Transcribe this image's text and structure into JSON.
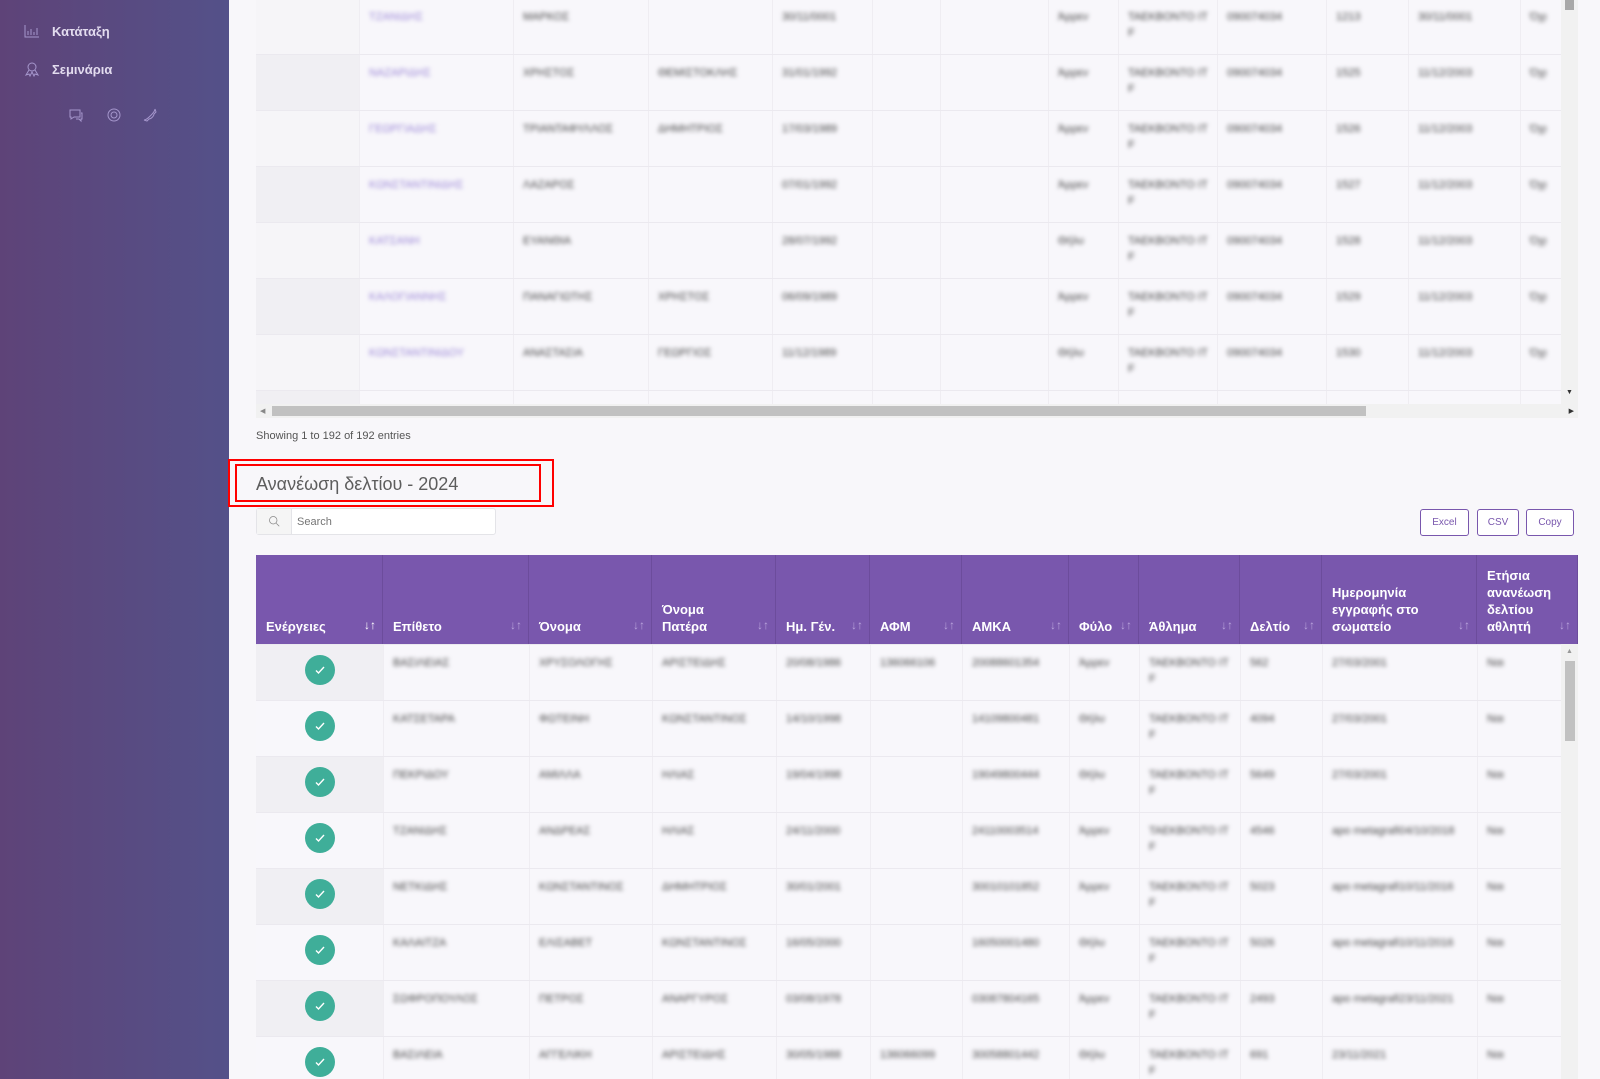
{
  "sidebar": {
    "items": [
      {
        "label": "Κατάταξη",
        "icon": "bar-chart-icon"
      },
      {
        "label": "Σεμινάρια",
        "icon": "award-icon"
      }
    ],
    "footer_icons": [
      "chat-icon",
      "lifebuoy-icon",
      "phone-icon"
    ]
  },
  "top_table": {
    "rows": [
      [
        "",
        "ΤΖΑΝΙΔΗΣ",
        "ΜΑΡΚΟΣ",
        "",
        "30/11/0001",
        "",
        "",
        "Άρρεν",
        "ΤΑΕΚΒΟΝΤΟ ITF",
        "090074034",
        "1213",
        "30/11/0001",
        "Όχι"
      ],
      [
        "",
        "ΝΑΖΑΡΙΔΗΣ",
        "ΧΡΗΣΤΟΣ",
        "ΘΕΜΙΣΤΟΚΛΗΣ",
        "31/01/1992",
        "",
        "",
        "Άρρεν",
        "ΤΑΕΚΒΟΝΤΟ ITF",
        "090074034",
        "1525",
        "11/12/2003",
        "Όχι"
      ],
      [
        "",
        "ΓΕΩΡΓΙΑΔΗΣ",
        "ΤΡΙΑΝΤΑΦΥΛΛΟΣ",
        "ΔΗΜΗΤΡΙΟΣ",
        "17/03/1989",
        "",
        "",
        "Άρρεν",
        "ΤΑΕΚΒΟΝΤΟ ITF",
        "090074034",
        "1526",
        "11/12/2003",
        "Όχι"
      ],
      [
        "",
        "ΚΩΝΣΤΑΝΤΙΝΙΔΗΣ",
        "ΛΑΖΑΡΟΣ",
        "",
        "07/01/1992",
        "",
        "",
        "Άρρεν",
        "ΤΑΕΚΒΟΝΤΟ ITF",
        "090074034",
        "1527",
        "11/12/2003",
        "Όχι"
      ],
      [
        "",
        "ΚΑΤΣΑΝΗ",
        "ΕΥΑΝΘΙΑ",
        "",
        "28/07/1992",
        "",
        "",
        "Θήλυ",
        "ΤΑΕΚΒΟΝΤΟ ITF",
        "090074034",
        "1528",
        "11/12/2003",
        "Όχι"
      ],
      [
        "",
        "ΚΑΛΟΓΙΑΝΝΗΣ",
        "ΠΑΝΑΓΙΩΤΗΣ",
        "ΧΡΗΣΤΟΣ",
        "06/09/1989",
        "",
        "",
        "Άρρεν",
        "ΤΑΕΚΒΟΝΤΟ ITF",
        "090074034",
        "1529",
        "11/12/2003",
        "Όχι"
      ],
      [
        "",
        "ΚΩΝΣΤΑΝΤΙΝΙΔΟΥ",
        "ΑΝΑΣΤΑΣΙΑ",
        "ΓΕΩΡΓΙΟΣ",
        "11/12/1989",
        "",
        "",
        "Θήλυ",
        "ΤΑΕΚΒΟΝΤΟ ITF",
        "090074034",
        "1530",
        "11/12/2003",
        "Όχι"
      ]
    ],
    "info": "Showing 1 to 192 of 192 entries"
  },
  "section": {
    "title": "Ανανέωση δελτίου - 2024",
    "search_placeholder": "Search",
    "buttons": [
      "Excel",
      "CSV",
      "Copy"
    ]
  },
  "bottom_table": {
    "headers": [
      "Ενέργειες",
      "Επίθετο",
      "Όνομα",
      "Όνομα Πατέρα",
      "Ημ. Γέν.",
      "ΑΦΜ",
      "ΑΜΚΑ",
      "Φύλο",
      "Άθλημα",
      "Δελτίο",
      "Ημερομηνία εγγραφής στο σωματείο",
      "Ετήσια ανανέωση δελτίου αθλητή"
    ],
    "action_icon": "check-circle-icon",
    "rows": [
      [
        "ΒΑΣΙΛΕΙΑΣ",
        "ΧΡΥΣΟΛΟΓΗΣ",
        "ΑΡΙΣΤΕΙΔΗΣ",
        "20/08/1986",
        "136066106",
        "20088601354",
        "Άρρεν",
        "ΤΑΕΚΒΟΝΤΟ ITF",
        "562",
        "27/03/2001",
        "Ναι"
      ],
      [
        "ΚΑΤΣΕΤΑΡΑ",
        "ΦΩΤΕΙΝΗ",
        "ΚΩΝΣΤΑΝΤΙΝΟΣ",
        "14/10/1998",
        "",
        "14109800481",
        "Θήλυ",
        "ΤΑΕΚΒΟΝΤΟ ITF",
        "4094",
        "27/03/2001",
        "Ναι"
      ],
      [
        "ΠΕΚΡΙΔΟΥ",
        "ΑΜΙΛΛΑ",
        "ΗΛΙΑΣ",
        "19/04/1998",
        "",
        "19049800444",
        "Θήλυ",
        "ΤΑΕΚΒΟΝΤΟ ITF",
        "5649",
        "27/03/2001",
        "Ναι"
      ],
      [
        "ΤΖΑΝΙΔΗΣ",
        "ΑΝΔΡΕΑΣ",
        "ΗΛΙΑΣ",
        "24/11/2000",
        "",
        "24110003514",
        "Άρρεν",
        "ΤΑΕΚΒΟΝΤΟ ITF",
        "4546",
        "apo metagrafi04/10/2018",
        "Ναι"
      ],
      [
        "ΝΕΤΚΙΔΗΣ",
        "ΚΩΝΣΤΑΝΤΙΝΟΣ",
        "ΔΗΜΗΤΡΙΟΣ",
        "30/01/2001",
        "",
        "30010101852",
        "Άρρεν",
        "ΤΑΕΚΒΟΝΤΟ ITF",
        "5023",
        "apo metagrafi10/11/2016",
        "Ναι"
      ],
      [
        "ΚΑΛΑΙΤΖΑ",
        "ΕΛΙΣΑΒΕΤ",
        "ΚΩΝΣΤΑΝΤΙΝΟΣ",
        "16/05/2000",
        "",
        "16050001480",
        "Θήλυ",
        "ΤΑΕΚΒΟΝΤΟ ITF",
        "5026",
        "apo metagrafi10/11/2016",
        "Ναι"
      ],
      [
        "ΣΩΦΡΟΠΟΥΛΟΣ",
        "ΠΕΤΡΟΣ",
        "ΑΝΑΡΓΥΡΟΣ",
        "03/08/1978",
        "",
        "03087804165",
        "Άρρεν",
        "ΤΑΕΚΒΟΝΤΟ ITF",
        "2493",
        "apo metagrafi23/11/2021",
        "Ναι"
      ],
      [
        "ΒΑΣΙΛΕΙΑ",
        "ΑΓΓΕΛΙΚΗ",
        "ΑΡΙΣΤΕΙΔΗΣ",
        "30/05/1988",
        "136066099",
        "30058801442",
        "Θήλυ",
        "ΤΑΕΚΒΟΝΤΟ ITF",
        "691",
        "23/11/2021",
        "Ναι"
      ]
    ]
  },
  "colors": {
    "header": "#7957ad",
    "check": "#3fae99",
    "highlight": "#ff0000",
    "link": "#9a86d6"
  }
}
